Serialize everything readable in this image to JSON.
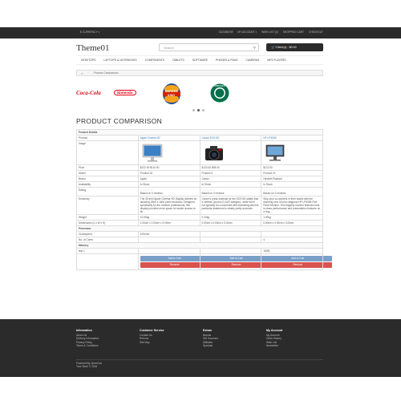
{
  "topbar": {
    "currency": "$ CURRENCY ▾",
    "links": [
      "0123456789",
      "MY ACCOUNT ▾",
      "WISH LIST (0)",
      "SHOPPING CART",
      "CHECKOUT"
    ]
  },
  "header": {
    "logo": "Theme01",
    "search_placeholder": "Search",
    "cart_label": "0 item(s) - $0.00"
  },
  "menu": [
    "DESKTOPS",
    "LAPTOPS & NOTEBOOKS",
    "COMPONENTS",
    "TABLETS",
    "SOFTWARE",
    "PHONES & PDAS",
    "CAMERAS",
    "MP3 PLAYERS"
  ],
  "breadcrumb": {
    "current": "Product Comparison"
  },
  "brands": {
    "coca": "Coca-Cola",
    "nintendo": "Nintendo",
    "bk_top": "BURGER",
    "bk_bottom": "KING",
    "starbucks": "STARBUCKS"
  },
  "page_title": "PRODUCT COMPARISON",
  "comparison": {
    "section_details": "Product Details",
    "labels": {
      "product": "Product",
      "image": "Image",
      "price": "Price",
      "model": "Model",
      "brand": "Brand",
      "availability": "Availability",
      "rating": "Rating",
      "summary": "Summary",
      "weight": "Weight",
      "dimensions": "Dimensions (L x W x H)"
    },
    "products": [
      {
        "name": "Apple Cinema 30\"",
        "price": "$122.00 $110.00",
        "model": "Product 15",
        "brand": "Apple",
        "availability": "In Stock",
        "rating": "Based on 0 reviews.",
        "summary": "The 30-inch Apple Cinema HD Display delivers an amazing 2560 x 1600 pixel resolution. Designed specifically for the creative professional, this display provides more space for easier access to all...",
        "weight": "12.50kg",
        "dimensions": "1.00cm x 2.00cm x 3.00cm"
      },
      {
        "name": "Canon EOS 5D",
        "price": "$122.00 $98.00",
        "model": "Product 3",
        "brand": "Canon",
        "availability": "In Stock",
        "rating": "Based on 0 reviews.",
        "summary": "Canon's press material for the EOS 5D states that it 'defines (a) new D-SLR category', while we're not typically too concerned with marketing talk this particular statement is clearly pretty accurate.",
        "weight": "0.00kg",
        "dimensions": "0.00cm x 0.00cm x 0.00cm"
      },
      {
        "name": "HP LP3065",
        "price": "$122.00",
        "model": "Product 21",
        "brand": "Hewlett-Packard",
        "availability": "In Stock",
        "rating": "Based on 0 reviews.",
        "summary": "Stop your co-workers in their tracks with the stunning new 30-inch diagonal HP LP3065 Flat Panel Monitor. This flagship monitor features best-in-class performance and presentation features on a hug...",
        "weight": "1.00kg",
        "dimensions": "0.00cm x 0.00cm x 0.00cm"
      }
    ],
    "section_processor": "Processor",
    "clockspeed_label": "Clockspeed",
    "clockspeed_values": [
      "100mhz",
      "",
      ""
    ],
    "cores_label": "No. of Cores",
    "cores_values": [
      "",
      "",
      "4"
    ],
    "section_memory": "Memory",
    "test1_label": "test 1",
    "test1_values": [
      "",
      "",
      "16GB"
    ],
    "add_to_cart": "Add to Cart",
    "remove": "Remove"
  },
  "footer": {
    "information": {
      "title": "Information",
      "items": [
        "About Us",
        "Delivery Information",
        "Privacy Policy",
        "Terms & Conditions"
      ]
    },
    "customer_service": {
      "title": "Customer Service",
      "items": [
        "Contact Us",
        "Returns",
        "Site Map"
      ]
    },
    "extras": {
      "title": "Extras",
      "items": [
        "Brands",
        "Gift Vouchers",
        "Affiliates",
        "Specials"
      ]
    },
    "my_account": {
      "title": "My Account",
      "items": [
        "My Account",
        "Order History",
        "Wish List",
        "Newsletter"
      ]
    },
    "powered_by": "Powered By OpenCart",
    "store": "Your Store © 2016"
  },
  "colors": {
    "dark_bar": "#2b2b2b",
    "link": "#337ab7",
    "cart_button": "#7a9fc9",
    "remove_button": "#d9534f"
  }
}
